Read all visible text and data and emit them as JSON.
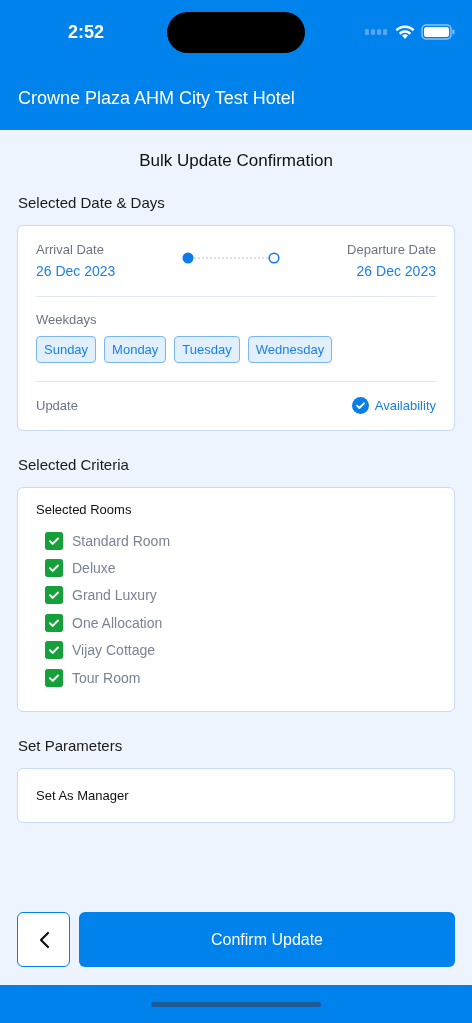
{
  "status_bar": {
    "time": "2:52"
  },
  "header": {
    "title": "Crowne Plaza AHM City Test Hotel"
  },
  "page_title": "Bulk Update Confirmation",
  "date_section": {
    "heading": "Selected Date & Days",
    "arrival_label": "Arrival Date",
    "arrival_date": "26 Dec 2023",
    "departure_label": "Departure Date",
    "departure_date": "26 Dec 2023",
    "weekdays_label": "Weekdays",
    "weekdays": [
      "Sunday",
      "Monday",
      "Tuesday",
      "Wednesday"
    ],
    "update_label": "Update",
    "update_value": {
      "label": "Availability",
      "checked": true
    }
  },
  "criteria_section": {
    "heading": "Selected Criteria",
    "rooms_label": "Selected Rooms",
    "rooms": [
      {
        "label": "Standard Room",
        "checked": true
      },
      {
        "label": "Deluxe",
        "checked": true
      },
      {
        "label": "Grand Luxury",
        "checked": true
      },
      {
        "label": "One Allocation",
        "checked": true
      },
      {
        "label": "Vijay Cottage",
        "checked": true
      },
      {
        "label": "Tour Room",
        "checked": true
      }
    ]
  },
  "parameters_section": {
    "heading": "Set Parameters",
    "value": "Set As Manager"
  },
  "footer": {
    "confirm_button": "Confirm Update"
  }
}
